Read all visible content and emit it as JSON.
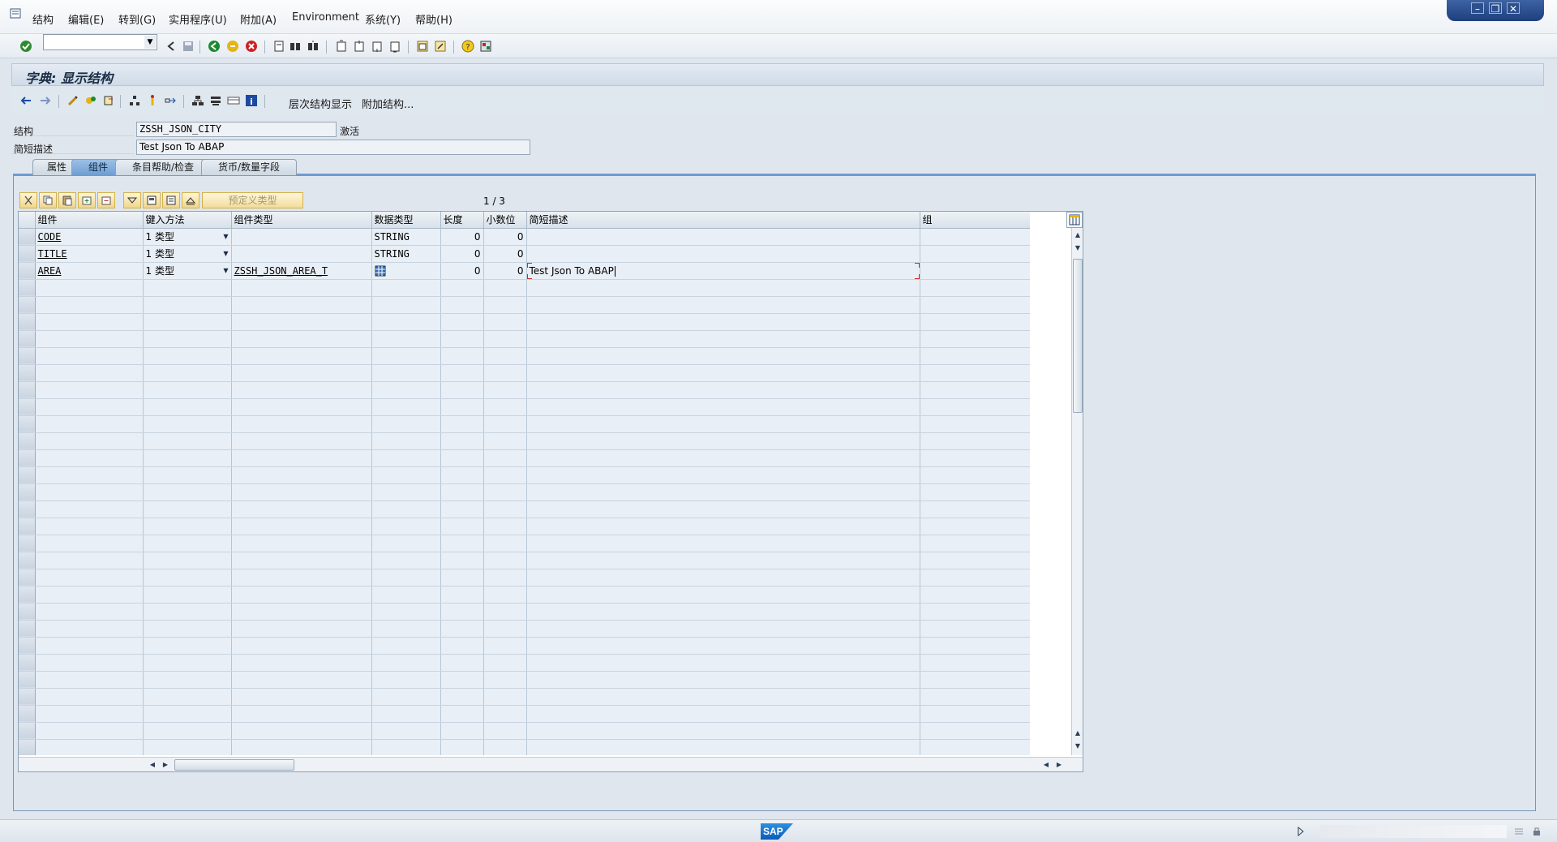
{
  "menu": {
    "items": [
      "结构",
      "编辑(E)",
      "转到(G)",
      "实用程序(U)",
      "附加(A)",
      "Environment",
      "系统(Y)",
      "帮助(H)"
    ]
  },
  "window_controls": {
    "minimize": "–",
    "restore": "❐",
    "close": "✕"
  },
  "system_toolbar": {
    "command_field_value": "",
    "icons": [
      "enter-icon",
      "back-icon",
      "save-icon",
      "back-green-icon",
      "exit-icon",
      "cancel-icon",
      "print-icon",
      "find-icon",
      "find-next-icon",
      "first-page-icon",
      "previous-page-icon",
      "next-page-icon",
      "last-page-icon",
      "create-session-icon",
      "shortcut-icon",
      "help-icon",
      "customize-layout-icon"
    ]
  },
  "title": "字典: 显示结构",
  "app_toolbar": {
    "hierarchy_label": "层次结构显示",
    "append_label": "附加结构..."
  },
  "header": {
    "structure_label": "结构",
    "structure_value": "ZSSH_JSON_CITY",
    "status": "激活",
    "short_desc_label": "简短描述",
    "short_desc_value": "Test Json To ABAP"
  },
  "tabs": [
    {
      "label": "属性",
      "active": false
    },
    {
      "label": "组件",
      "active": true
    },
    {
      "label": "条目帮助/检查",
      "active": false
    },
    {
      "label": "货币/数量字段",
      "active": false
    }
  ],
  "table_toolbar": {
    "predefined_type_label": "预定义类型",
    "page_counter": "1 / 3"
  },
  "grid": {
    "columns": [
      "组件",
      "键入方法",
      "组件类型",
      "数据类型",
      "长度",
      "小数位",
      "简短描述",
      "组"
    ],
    "rows": [
      {
        "component": "CODE",
        "typing": "1 类型",
        "comp_type": "",
        "data_type": "STRING",
        "length": "0",
        "decimals": "0",
        "description": "",
        "group": ""
      },
      {
        "component": "TITLE",
        "typing": "1 类型",
        "comp_type": "",
        "data_type": "STRING",
        "length": "0",
        "decimals": "0",
        "description": "",
        "group": ""
      },
      {
        "component": "AREA",
        "typing": "1 类型",
        "comp_type": "ZSSH_JSON_AREA_T",
        "data_type": "",
        "length": "0",
        "decimals": "0",
        "description": "Test Json To ABAP",
        "group": ""
      }
    ],
    "empty_row_count": 28
  },
  "status_bar": {
    "logo": "SAP"
  },
  "colors": {
    "tab_active": "#6d9ed2",
    "title_bg": "#cfdbe8",
    "grid_row": "#e9eff6",
    "edit_marker": "#e02020"
  }
}
